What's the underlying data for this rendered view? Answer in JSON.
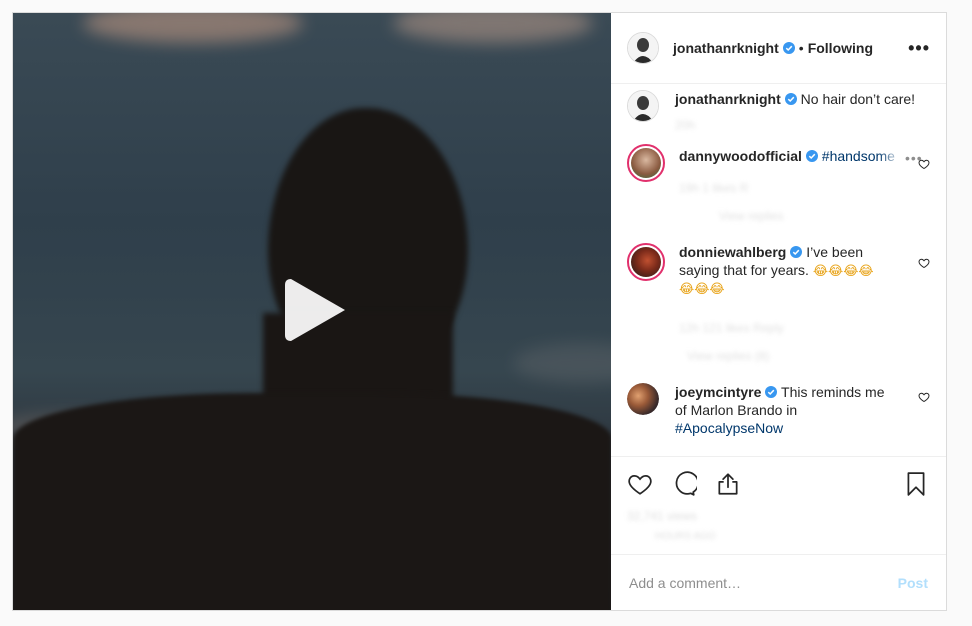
{
  "post": {
    "author": {
      "username": "jonathanrknight",
      "verified": true,
      "follow_state": "Following",
      "separator": "•"
    },
    "more_icon": "more-horizontal-icon",
    "caption": {
      "username": "jonathanrknight",
      "text": "No hair don’t care!",
      "time": "20h"
    },
    "comments": [
      {
        "username": "dannywoodofficial",
        "verified": true,
        "text": "#handsome",
        "faded_meta": "19h   1 likes   R",
        "faded_sub": "View replies"
      },
      {
        "username": "donniewahlberg",
        "verified": true,
        "text": "I’ve been saying that for years.",
        "emojis_line1": "😂😂😂😂",
        "emojis_line2": "😂😂😂",
        "faded_meta": "12h   121 likes   Reply",
        "faded_sub": "View replies (8)"
      },
      {
        "username": "joeymcintyre",
        "verified": true,
        "text_line1": "This reminds me",
        "text_line2": "of Marlon Brando in",
        "hashtag": "#ApocalypseNow"
      }
    ],
    "actions": {
      "like_icon": "heart-icon",
      "comment_icon": "comment-bubble-icon",
      "share_icon": "share-icon",
      "save_icon": "bookmark-icon"
    },
    "likes_faded": "32,741 views",
    "time_faded": "HOURS AGO",
    "comment_input": {
      "placeholder": "Add a comment…",
      "post_label": "Post"
    },
    "media": {
      "type": "video",
      "play_icon": "play-icon"
    }
  },
  "colors": {
    "verified_blue": "#3897f0",
    "hashtag_blue": "#00376b",
    "post_button_disabled": "#b2dffc",
    "story_ring": "#e1306c"
  }
}
